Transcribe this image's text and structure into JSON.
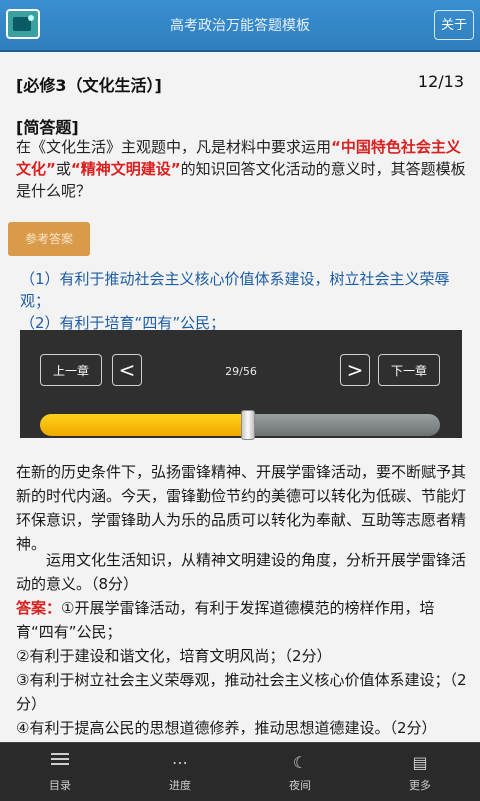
{
  "header": {
    "title": "高考政治万能答题模板",
    "about_label": "关于"
  },
  "question": {
    "chapter": "[必修3（文化生活）]",
    "index": "12/13",
    "type": "[简答题]",
    "text_before": "在《文化生活》主观题中，凡是材料中要求运用",
    "highlight1": "“中国特色社会主义文化”",
    "text_mid": "或",
    "highlight2": "“精神文明建设”",
    "text_after": "的知识回答文化活动的意义时，其答题模板是什么呢？"
  },
  "reference_button": "参考答案",
  "answers": {
    "line1": "（1）有利于推动社会主义核心价值体系建设，树立社会主义荣辱观；",
    "line2": "（2）有利于培育“四有”公民；"
  },
  "example": {
    "story": "在新的历史条件下，弘扬雷锋精神、开展学雷锋活动，要不断赋予其新的时代内涵。今天，雷锋勤俭节约的美德可以转化为低碳、节能灯环保意识，学雷锋助人为乐的品质可以转化为奉献、互助等志愿者精神。",
    "task": "运用文化生活知识，从精神文明建设的角度，分析开展学雷锋活动的意义。（8分）",
    "answer_label": "答案：",
    "answer_1": "①开展学雷锋活动，有利于发挥道德模范的榜样作用，培育“四有”公民；",
    "answer_2": "②有利于建设和谐文化，培育文明风尚；（2分）",
    "answer_3": "③有利于树立社会主义荣辱观，推动社会主义核心价值体系建设；（2分）",
    "answer_4": "④有利于提高公民的思想道德修养，推动思想道德建设。（2分）"
  },
  "progress": {
    "prev_chapter": "上一章",
    "next_chapter": "下一章",
    "prev_arrow": "<",
    "next_arrow": ">",
    "position": "29/56",
    "fill_fraction": 0.52,
    "fill_color": "#f6c000"
  },
  "bottom_nav": {
    "items": [
      {
        "label": "目录",
        "icon": "list-icon"
      },
      {
        "label": "进度",
        "icon": "progress-icon"
      },
      {
        "label": "夜间",
        "icon": "moon-icon"
      },
      {
        "label": "更多",
        "icon": "document-icon"
      }
    ]
  }
}
